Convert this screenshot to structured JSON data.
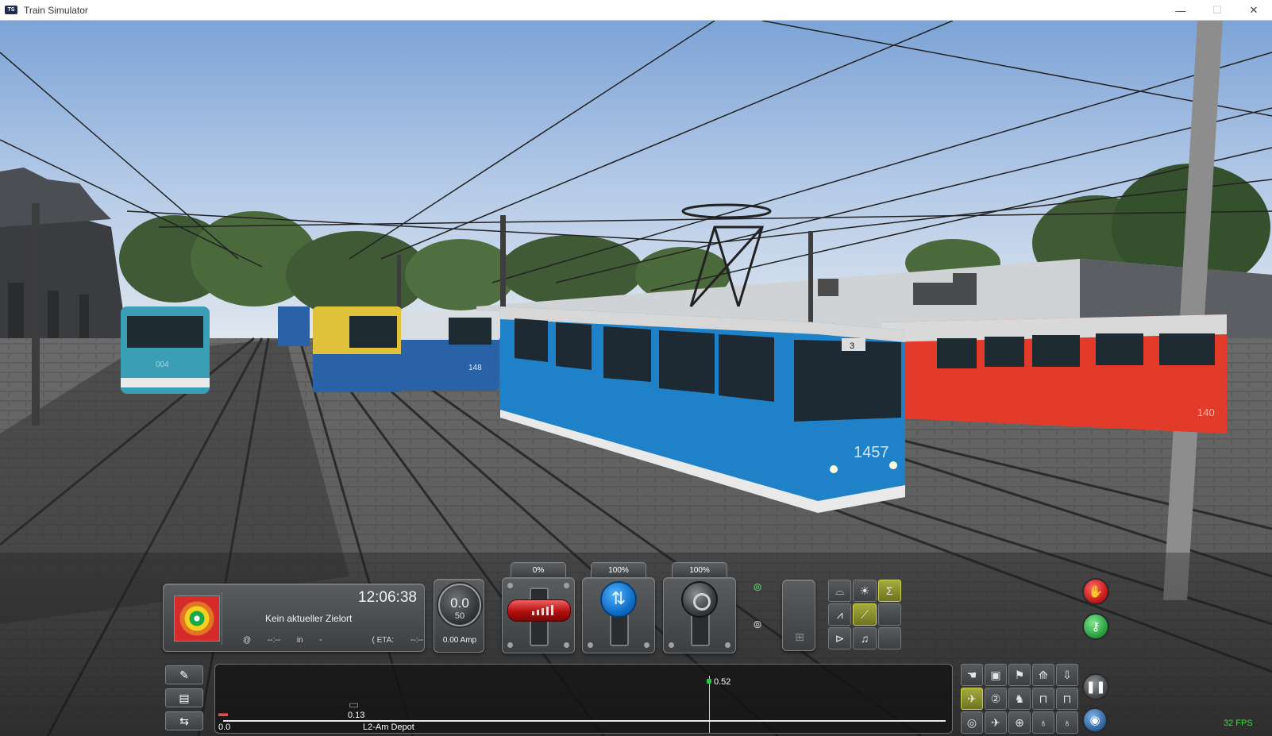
{
  "window": {
    "app_icon_label": "TS",
    "title": "Train Simulator",
    "minimize": "—",
    "maximize": "☐",
    "close": "✕"
  },
  "scene": {
    "trams": [
      {
        "number": "004",
        "color": "#3a9fb5"
      },
      {
        "number": "148",
        "color": "#2a62a8"
      },
      {
        "number": "1457",
        "color": "#1f82c9"
      },
      {
        "number": "140",
        "color": "#e23b2a"
      }
    ],
    "route_board": "3"
  },
  "hud": {
    "time": "12:06:38",
    "destination": "Kein aktueller Zielort",
    "at_symbol": "@",
    "at_time": "--:--",
    "in_label": "in",
    "in_value": "-",
    "eta_label": "( ETA:",
    "eta_value": "--:--",
    "eta_close": ")",
    "speed": "0.0",
    "speed_limit": "50",
    "ammeter": "0.00 Amp",
    "lever_throttle_pct": "0%",
    "lever_reverser_pct": "100%",
    "lever_brake_pct": "100%",
    "track": {
      "start": "0.0",
      "train_pos": "0.13",
      "marker": "0.52",
      "location": "L2-Am Depot"
    },
    "fps": "32 FPS"
  },
  "colors": {
    "accent_green": "#3ddc3d",
    "brake_red": "#c41414",
    "knob_blue": "#0f6ec8",
    "active_olive": "#a5ab3c"
  },
  "icons": {
    "grid3": [
      "wiper-icon",
      "headlight-icon",
      "sigma-icon",
      "pantograph-icon",
      "sander-icon",
      "blank",
      "horn-icon",
      "bell-icon",
      "blank"
    ],
    "grid6": [
      "hand-icon",
      "tram-icon",
      "signal-icon",
      "crane-icon",
      "down-arrow-icon",
      "camera-cab-icon",
      "camera-2-icon",
      "camera-passenger-icon",
      "coupler-icon",
      "tram-front-icon",
      "camera-free-icon",
      "camera-plane-icon",
      "globe-icon",
      "pin-icon",
      "map-icon"
    ]
  }
}
